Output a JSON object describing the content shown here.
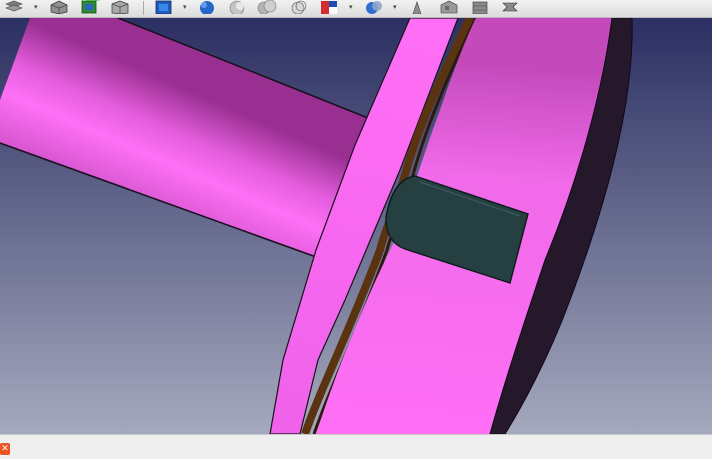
{
  "toolbar": {
    "groups": [
      {
        "name": "workbench",
        "icons": [
          "layers-icon",
          "part-box-icon",
          "fem-icon",
          "cube-icon"
        ]
      },
      {
        "name": "views",
        "icons": [
          "view-cube-icon",
          "sphere-icon",
          "torus-icon",
          "cylinder-icon",
          "cone-icon",
          "section-icon",
          "wedge-icon",
          "tube-icon",
          "shape-icon",
          "extrude-icon",
          "revolve-icon"
        ]
      }
    ]
  },
  "viewport": {
    "background_top": "#2b2f62",
    "background_bottom": "#a5a9bd",
    "part_color": "#ff6ff6",
    "part_shadow": "#9a2f92",
    "slot_color": "#263f40",
    "rim_color": "#26182b",
    "groove_color": "#5a3410"
  },
  "statusbar": {
    "close_icon": "close-icon",
    "close_color": "#e95420"
  }
}
